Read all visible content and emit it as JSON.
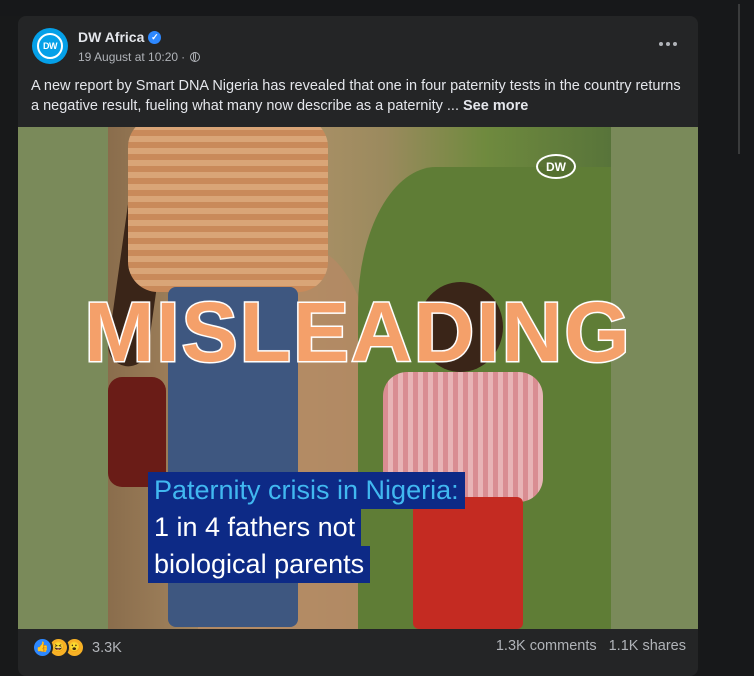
{
  "post": {
    "page_name": "DW Africa",
    "timestamp": "19 August at 10:20",
    "separator": "·",
    "avatar_text": "DW",
    "caption": "A new report by Smart DNA Nigeria has revealed that one in four paternity tests in the country returns a negative result, fueling what many now describe as a paternity ... ",
    "see_more": "See more"
  },
  "media": {
    "logo_text": "DW",
    "overlay_lines": [
      "Paternity crisis in Nigeria:",
      "1 in 4 fathers not",
      "biological parents"
    ],
    "stamp": "MISLEADING"
  },
  "footer": {
    "reaction_icons": [
      "like-icon",
      "haha-icon",
      "wow-icon"
    ],
    "reaction_count": "3.3K",
    "comments": "1.3K comments",
    "shares": "1.1K shares"
  },
  "colors": {
    "card_bg": "#242526",
    "stamp": "#f4a06a",
    "overlay_box": "#0d2a86",
    "overlay_highlight": "#41b8f0",
    "verified": "#2d88ff"
  }
}
